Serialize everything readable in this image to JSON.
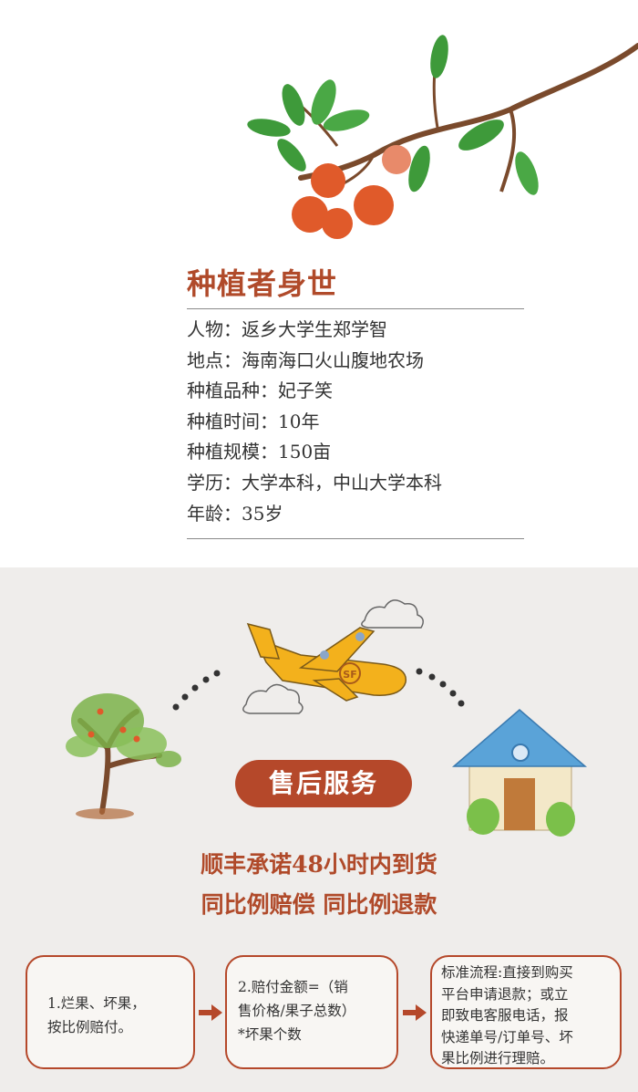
{
  "bio": {
    "title": "种植者身世",
    "items": [
      {
        "label": "人物",
        "value": "返乡大学生郑学智"
      },
      {
        "label": "地点",
        "value": "海南海口火山腹地农场"
      },
      {
        "label": "种植品种",
        "value": "妃子笑"
      },
      {
        "label": "种植时间",
        "value": "10年"
      },
      {
        "label": "种植规模",
        "value": "150亩"
      },
      {
        "label": "学历",
        "value": "大学本科，中山大学本科"
      },
      {
        "label": "年龄",
        "value": "35岁"
      }
    ],
    "separator": "："
  },
  "service": {
    "title": "售后服务",
    "plane_logo": "SF",
    "promise_line1": "顺丰承诺48小时内到货",
    "promise_line2": "同比例赔偿 同比例退款"
  },
  "steps": [
    {
      "line1": "1.烂果、坏果，",
      "line2": "按比例赔付。"
    },
    {
      "line1": "2.赔付金额=（销",
      "line2": "售价格/果子总数）",
      "line3": "*坏果个数"
    },
    {
      "line1": "标准流程:直接到购买",
      "line2": "平台申请退款；或立",
      "line3": "即致电客服电话，报",
      "line4": "快递单号/订单号、坏",
      "line5": "果比例进行理赔。"
    }
  ],
  "colors": {
    "accent": "#b5482a",
    "title": "#b04a2a",
    "leaf": "#3e9a3a",
    "fruit": "#e05a2a",
    "plane": "#f3b11c",
    "roof": "#5aa3d8",
    "panel_bg": "#efedeb"
  },
  "icons": [
    "lychee-branch-icon",
    "airplane-icon",
    "cloud-icon",
    "tree-icon",
    "house-icon",
    "arrow-right-icon"
  ]
}
